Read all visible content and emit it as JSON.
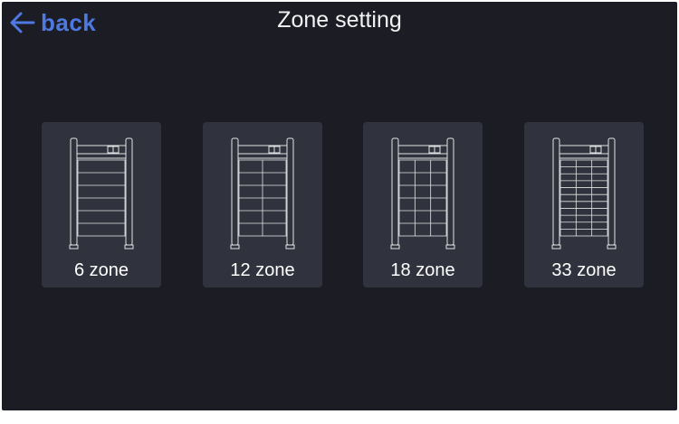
{
  "header": {
    "back_label": "back",
    "title": "Zone setting",
    "back_icon": "arrow-left-icon",
    "accent_color": "#4e79e0"
  },
  "zones": [
    {
      "label": "6 zone",
      "columns": 1,
      "rows": 6
    },
    {
      "label": "12 zone",
      "columns": 2,
      "rows": 6
    },
    {
      "label": "18 zone",
      "columns": 3,
      "rows": 6
    },
    {
      "label": "33 zone",
      "columns": 3,
      "rows": 11
    }
  ],
  "colors": {
    "background": "#1b1c24",
    "card": "#30323d",
    "gate_stroke": "#e4e4e4"
  }
}
